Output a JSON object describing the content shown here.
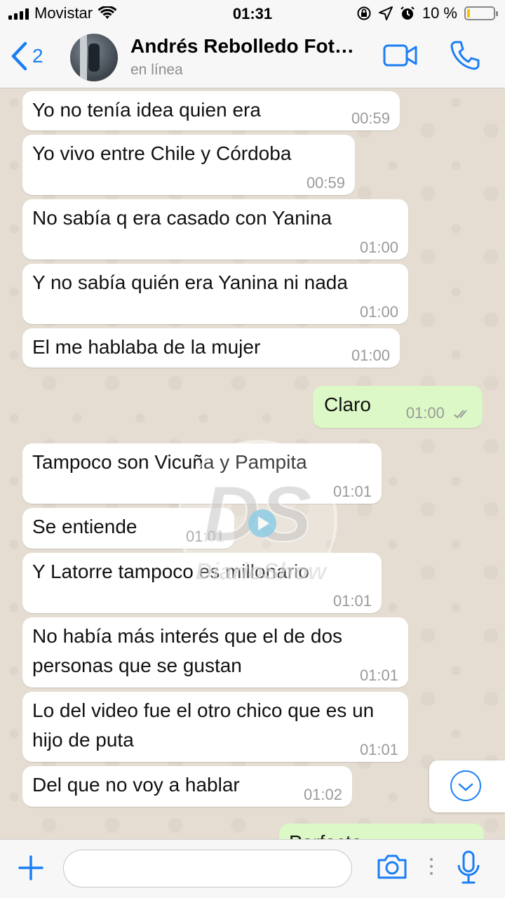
{
  "status_bar": {
    "carrier": "Movistar",
    "time": "01:31",
    "battery_text": "10 %",
    "battery_level": 0.1
  },
  "header": {
    "back_count": "2",
    "contact_name": "Andrés Rebolledo Fot…",
    "contact_status": "en línea"
  },
  "messages": [
    {
      "text": "Yo no tenía idea quien era",
      "time": "00:59",
      "direction": "in"
    },
    {
      "text": "Yo vivo entre Chile y Córdoba",
      "time": "00:59",
      "direction": "in"
    },
    {
      "text": "No sabía q era casado con Yanina",
      "time": "01:00",
      "direction": "in"
    },
    {
      "text": "Y no sabía quién era Yanina ni nada",
      "time": "01:00",
      "direction": "in"
    },
    {
      "text": "El me hablaba de la mujer",
      "time": "01:00",
      "direction": "in"
    },
    {
      "text": "Claro",
      "time": "01:00",
      "direction": "out"
    },
    {
      "text": "Tampoco son Vicuña y Pampita",
      "time": "01:01",
      "direction": "in"
    },
    {
      "text": "Se entiende",
      "time": "01:01",
      "direction": "in"
    },
    {
      "text": "Y Latorre tampoco es millonario",
      "time": "01:01",
      "direction": "in"
    },
    {
      "text": "No había más interés que el de dos personas que se gustan",
      "time": "01:01",
      "direction": "in"
    },
    {
      "text": "Lo del video fue el otro chico que es un hijo de puta",
      "time": "01:01",
      "direction": "in"
    },
    {
      "text": "Del que no voy a hablar",
      "time": "01:02",
      "direction": "in"
    },
    {
      "text": "Perfecto",
      "time": "",
      "direction": "out"
    }
  ],
  "watermark": {
    "logo": "DS",
    "brand": "DiarioShow"
  },
  "composer": {
    "placeholder": ""
  },
  "colors": {
    "accent": "#1a7ef5",
    "outgoing_bubble": "#dcf8c6",
    "incoming_bubble": "#ffffff",
    "chat_background": "#e5ddd1"
  },
  "icons": [
    "back-chevron-icon",
    "video-call-icon",
    "phone-icon",
    "plus-icon",
    "camera-icon",
    "microphone-icon",
    "chevron-down-icon",
    "wifi-icon",
    "signal-icon",
    "battery-icon",
    "double-check-icon"
  ]
}
